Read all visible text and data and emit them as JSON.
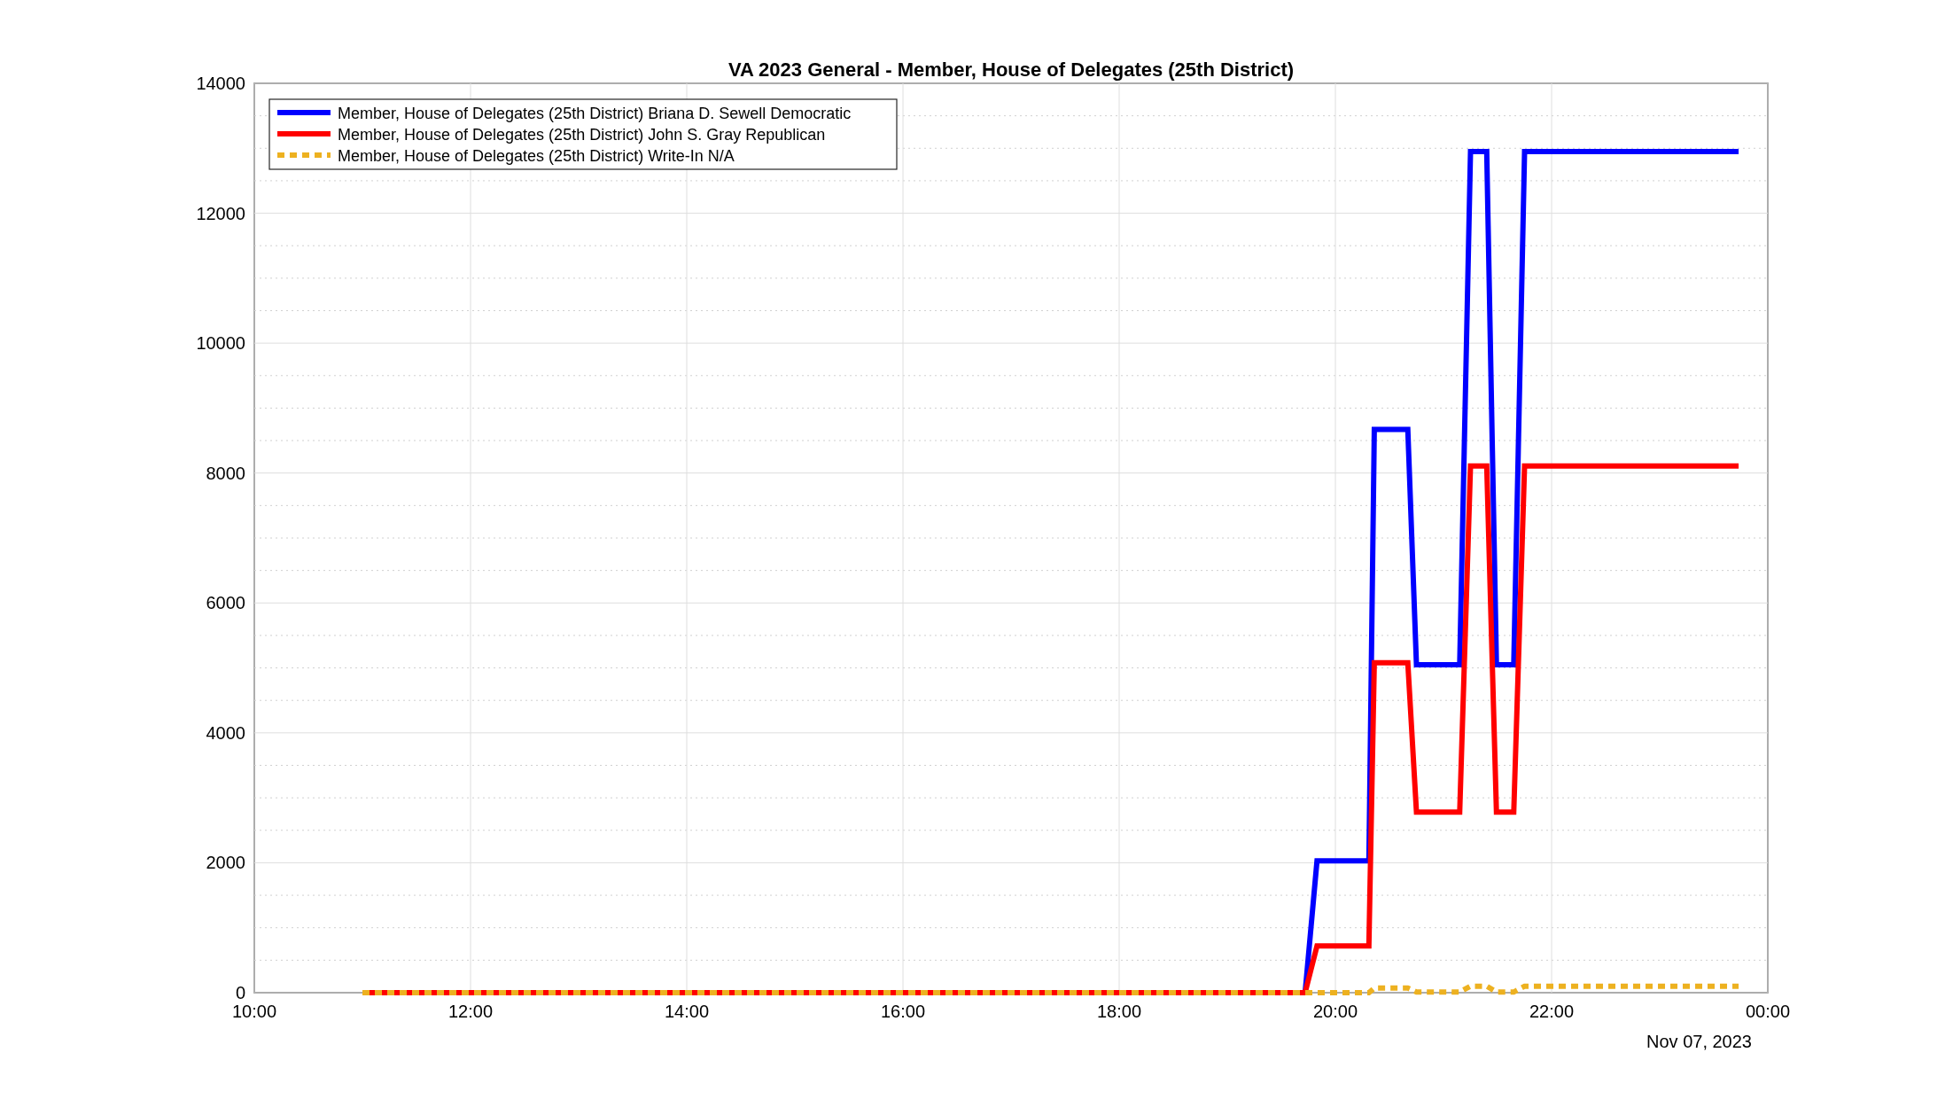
{
  "figure": {
    "chart_data": {
      "type": "line",
      "title": "VA 2023 General - Member, House of Delegates (25th District)",
      "x": [
        11,
        19.72,
        19.83,
        20.31,
        20.36,
        20.67,
        20.75,
        21.15,
        21.25,
        21.4,
        21.49,
        21.65,
        21.75,
        23.73
      ],
      "series": [
        {
          "name": "Member, House of Delegates (25th District) Briana D. Sewell Democratic",
          "color": "#0000ff",
          "values": [
            0,
            0,
            2030,
            2030,
            8670,
            8670,
            5050,
            5050,
            12950,
            12950,
            5050,
            5050,
            12950,
            12950
          ]
        },
        {
          "name": "Member, House of Delegates (25th District) John S. Gray Republican",
          "color": "#ff0000",
          "values": [
            0,
            0,
            720,
            720,
            5080,
            5080,
            2780,
            2780,
            8110,
            8110,
            2780,
            2780,
            8110,
            8110
          ]
        },
        {
          "name": "Member, House of Delegates (25th District) Write-In N/A",
          "color": "#edb120",
          "line_style": "dotted",
          "values": [
            0,
            0,
            0,
            0,
            70,
            70,
            10,
            10,
            100,
            100,
            10,
            10,
            100,
            100
          ]
        }
      ],
      "xlim": [
        10,
        24
      ],
      "ylim": [
        0,
        14000
      ],
      "xticks": [
        {
          "value": 10,
          "label": "10:00"
        },
        {
          "value": 12,
          "label": "12:00"
        },
        {
          "value": 14,
          "label": "14:00"
        },
        {
          "value": 16,
          "label": "16:00"
        },
        {
          "value": 18,
          "label": "18:00"
        },
        {
          "value": 20,
          "label": "20:00"
        },
        {
          "value": 22,
          "label": "22:00"
        },
        {
          "value": 24,
          "label": "00:00"
        }
      ],
      "yticks": [
        0,
        2000,
        4000,
        6000,
        8000,
        10000,
        12000,
        14000
      ],
      "grid": true,
      "legend": "upper left"
    },
    "date_label": "Nov 07, 2023"
  }
}
